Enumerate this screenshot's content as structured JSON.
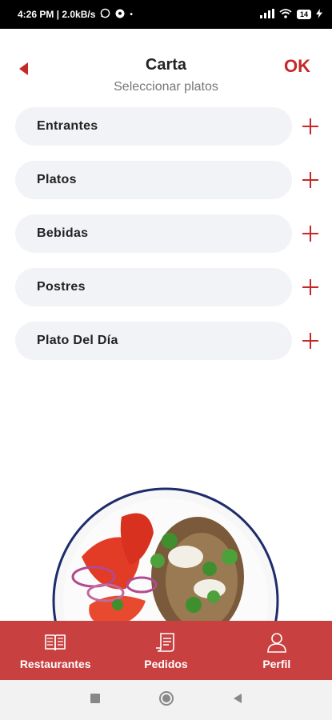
{
  "status_bar": {
    "time_info": "4:26 PM | 2.0kB/s",
    "battery": "14"
  },
  "header": {
    "title": "Carta",
    "subtitle": "Seleccionar platos",
    "ok_label": "OK"
  },
  "categories": [
    {
      "label": "Entrantes"
    },
    {
      "label": "Platos"
    },
    {
      "label": "Bebidas"
    },
    {
      "label": "Postres"
    },
    {
      "label": "Plato Del Día"
    }
  ],
  "bottom_nav": [
    {
      "label": "Restaurantes",
      "icon": "book-icon"
    },
    {
      "label": "Pedidos",
      "icon": "receipt-icon"
    },
    {
      "label": "Perfil",
      "icon": "user-icon"
    }
  ],
  "colors": {
    "accent": "#c62828",
    "nav_bg": "#c94040",
    "pill_bg": "#f1f3f6"
  }
}
